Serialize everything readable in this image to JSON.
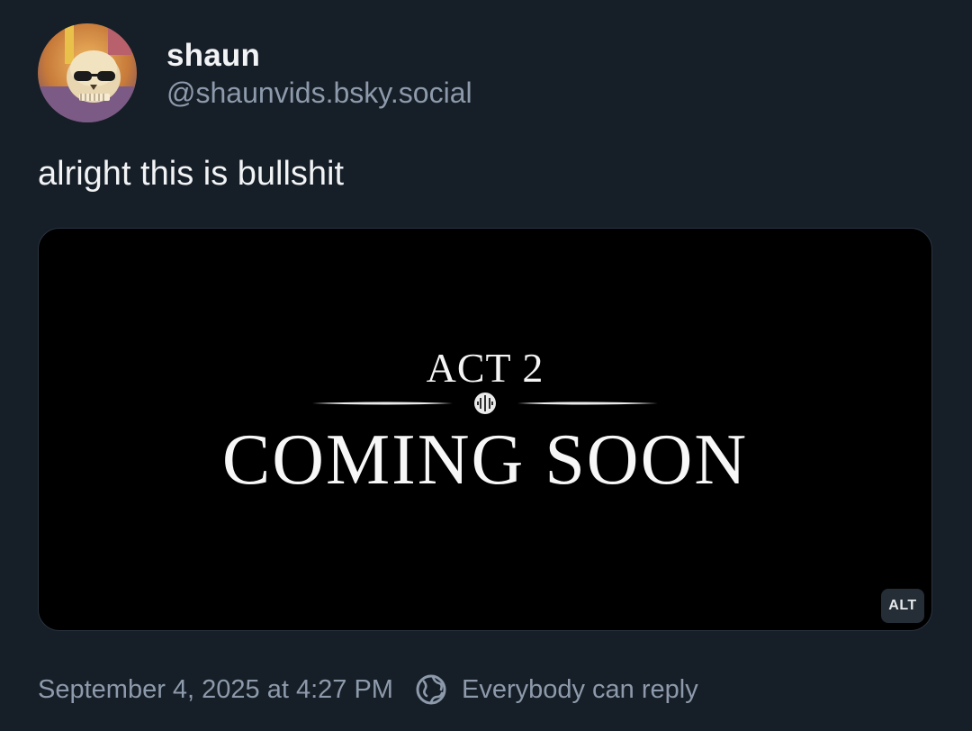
{
  "author": {
    "display_name": "shaun",
    "handle": "@shaunvids.bsky.social",
    "avatar_icon": "skull-avatar"
  },
  "post": {
    "text": "alright this is bullshit",
    "image": {
      "overline": "ACT 2",
      "headline": "COMING SOON",
      "alt_badge": "ALT"
    }
  },
  "footer": {
    "timestamp": "September 4, 2025 at 4:27 PM",
    "reply_icon": "globe-reply-icon",
    "reply_setting": "Everybody can reply"
  },
  "colors": {
    "background": "#161e27",
    "text_primary": "#f1f3f5",
    "text_muted": "#8d9aab",
    "media_background": "#000000"
  }
}
